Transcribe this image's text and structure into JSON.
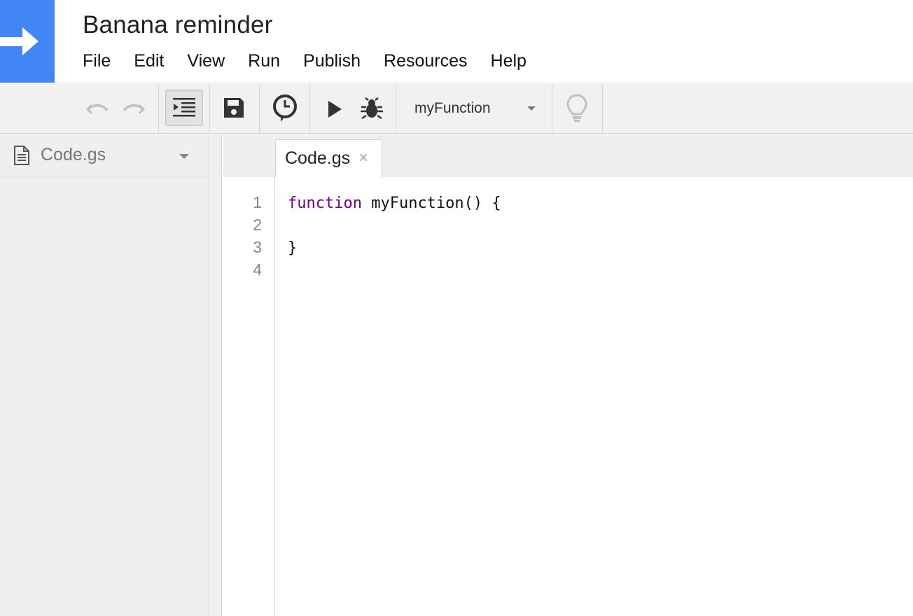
{
  "app": {
    "title": "Banana reminder",
    "accent_color": "#4285f4"
  },
  "menu": {
    "items": [
      "File",
      "Edit",
      "View",
      "Run",
      "Publish",
      "Resources",
      "Help"
    ]
  },
  "toolbar": {
    "icons": [
      "undo-icon",
      "redo-icon",
      "indent-icon",
      "save-icon",
      "triggers-icon",
      "run-icon",
      "debug-icon",
      "lightbulb-icon"
    ],
    "function_select": "myFunction"
  },
  "sidebar": {
    "file_name": "Code.gs"
  },
  "editor": {
    "tab_label": "Code.gs",
    "tab_close": "×",
    "line_numbers": [
      "1",
      "2",
      "3",
      "4"
    ],
    "code": {
      "line1_keyword": "function",
      "line1_rest": " myFunction() {",
      "line2": "",
      "line3": "}",
      "line4": ""
    },
    "keyword_color": "#770088"
  }
}
